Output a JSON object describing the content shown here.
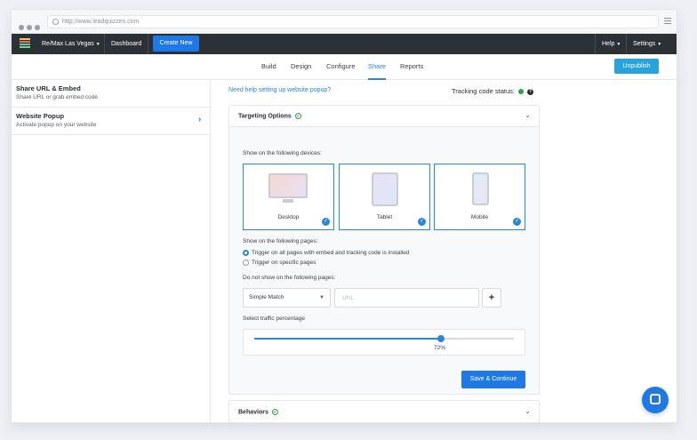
{
  "browser": {
    "url": "http://www.leadquizzes.com"
  },
  "topnav": {
    "account": "Re/Max Las Vegas",
    "dashboard": "Dashboard",
    "create_new": "Create New",
    "help": "Help",
    "settings": "Settings"
  },
  "tabs": [
    {
      "label": "Build"
    },
    {
      "label": "Design"
    },
    {
      "label": "Configure"
    },
    {
      "label": "Share",
      "active": true
    },
    {
      "label": "Reports"
    }
  ],
  "unpublish": "Unpublish",
  "sidebar": {
    "items": [
      {
        "title": "Share URL & Embed",
        "subtitle": "Share URL or grab embed code"
      },
      {
        "title": "Website Popup",
        "subtitle": "Activate popup on your website"
      }
    ]
  },
  "main": {
    "help_link": "Need help setting up website popup?",
    "tracking_label": "Tracking code status:",
    "targeting": {
      "title": "Targeting Options",
      "devices_label": "Show on the following devices:",
      "devices": [
        {
          "name": "Desktop",
          "checked": true
        },
        {
          "name": "Tablet",
          "checked": true
        },
        {
          "name": "Mobile",
          "checked": true
        }
      ],
      "pages_label": "Show on the following pages:",
      "page_options": [
        {
          "label": "Trigger on all pages with embed and tracking code is installed",
          "selected": true
        },
        {
          "label": "Trigger on specific pages",
          "selected": false
        }
      ],
      "exclude_label": "Do not show on the following pages:",
      "match_select": "Simple Match",
      "url_placeholder": "URL",
      "add_symbol": "+",
      "traffic_label": "Select traffic percentage",
      "traffic_value": "72%",
      "traffic_fraction": 0.72,
      "save_label": "Save & Continue"
    },
    "behaviors": {
      "title": "Behaviors"
    }
  },
  "colors": {
    "accent": "#1e78e6",
    "tab_active": "#2a86d8",
    "status_ok": "#2aa04a",
    "nav_bg": "#2c3136"
  }
}
